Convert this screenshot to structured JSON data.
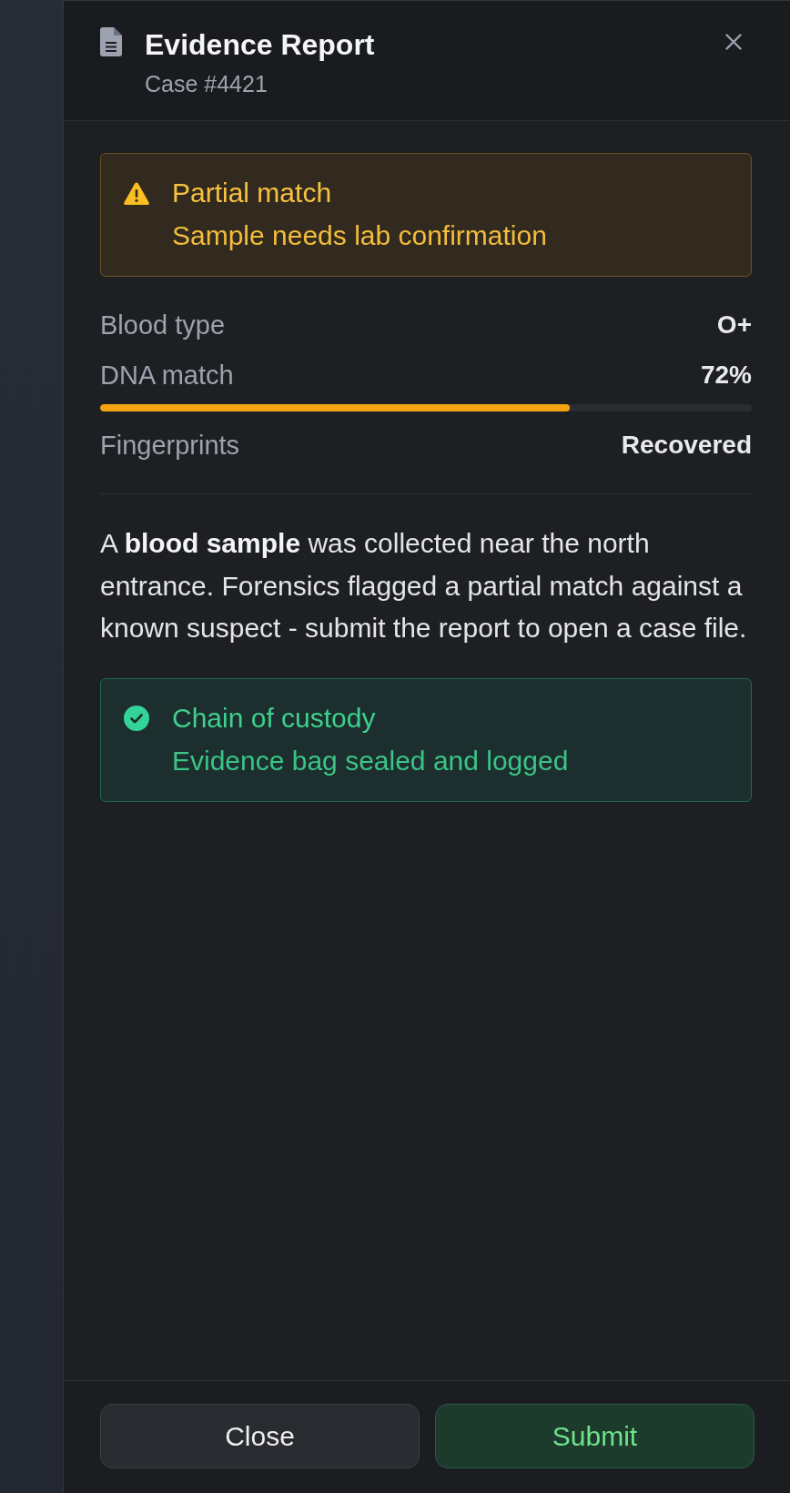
{
  "header": {
    "title": "Evidence Report",
    "subtitle": "Case #4421"
  },
  "warning_alert": {
    "kind": "warning",
    "title": "Partial match",
    "message": "Sample needs lab confirmation"
  },
  "facts": [
    {
      "kind": "plain",
      "label": "Blood type",
      "value": "O+"
    },
    {
      "kind": "meter",
      "label": "DNA match",
      "value": "72%",
      "level": 0.72
    },
    {
      "kind": "plain",
      "label": "Fingerprints",
      "value": "Recovered"
    }
  ],
  "description": "A **blood sample** was collected near the north entrance. Forensics flagged a partial match against a known suspect - submit the report to open a case file.",
  "custody_alert": {
    "kind": "success",
    "title": "Chain of custody",
    "message": "Evidence bag sealed and logged"
  },
  "buttons": [
    {
      "kind": "close",
      "label": "Close"
    },
    {
      "kind": "submit",
      "label": "Submit"
    }
  ]
}
